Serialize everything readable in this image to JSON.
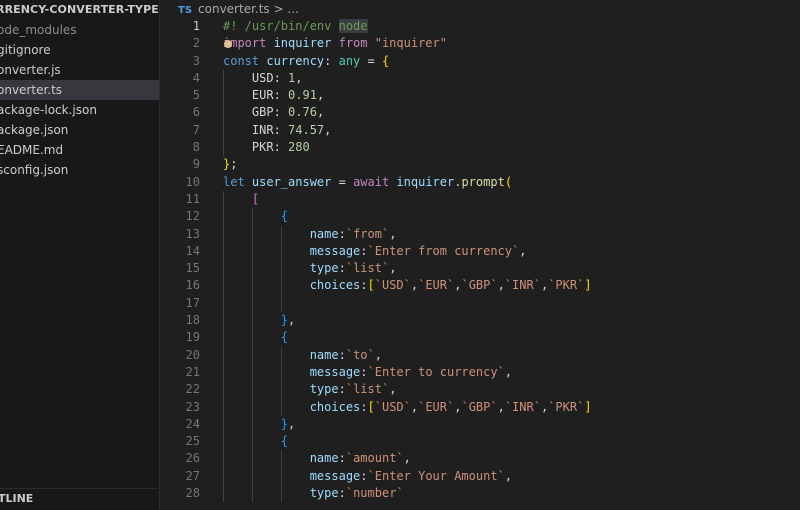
{
  "sidebar": {
    "project_title": "RRENCY-CONVERTER-TYPESCRIPT",
    "items": [
      {
        "label": "ode_modules",
        "dim": true
      },
      {
        "label": "gitignore"
      },
      {
        "label": "onverter.js"
      },
      {
        "label": "onverter.ts",
        "selected": true
      },
      {
        "label": "ackage-lock.json"
      },
      {
        "label": "ackage.json"
      },
      {
        "label": "EADME.md"
      },
      {
        "label": "sconfig.json"
      }
    ],
    "outline_label": "TLINE"
  },
  "breadcrumb": {
    "badge": "TS",
    "file": "converter.ts",
    "separator": ">",
    "rest": "..."
  },
  "code": {
    "lines": [
      [
        [
          "c",
          "#! /usr/bin/env "
        ],
        [
          "c hl",
          "node"
        ]
      ],
      [
        [
          "k",
          "import "
        ],
        [
          "v",
          "inquirer "
        ],
        [
          "k",
          "from "
        ],
        [
          "s",
          "\"inquirer\""
        ]
      ],
      [
        [
          "kb",
          "const "
        ],
        [
          "v",
          "currency"
        ],
        [
          "p",
          ": "
        ],
        [
          "t",
          "any "
        ],
        [
          "p",
          "= "
        ],
        [
          "b1",
          "{"
        ]
      ],
      [
        [
          "p",
          "    USD: "
        ],
        [
          "n",
          "1"
        ],
        [
          "p",
          ","
        ]
      ],
      [
        [
          "p",
          "    EUR: "
        ],
        [
          "n",
          "0.91"
        ],
        [
          "p",
          ","
        ]
      ],
      [
        [
          "p",
          "    GBP: "
        ],
        [
          "n",
          "0.76"
        ],
        [
          "p",
          ","
        ]
      ],
      [
        [
          "p",
          "    INR: "
        ],
        [
          "n",
          "74.57"
        ],
        [
          "p",
          ","
        ]
      ],
      [
        [
          "p",
          "    PKR: "
        ],
        [
          "n",
          "280"
        ]
      ],
      [
        [
          "b1",
          "}"
        ],
        [
          "p",
          ";"
        ]
      ],
      [
        [
          "kb",
          "let "
        ],
        [
          "v",
          "user_answer "
        ],
        [
          "p",
          "= "
        ],
        [
          "k",
          "await "
        ],
        [
          "v",
          "inquirer"
        ],
        [
          "p",
          "."
        ],
        [
          "f",
          "prompt"
        ],
        [
          "b1",
          "("
        ]
      ],
      [
        [
          "p",
          "    "
        ],
        [
          "b2",
          "["
        ]
      ],
      [
        [
          "p",
          "        "
        ],
        [
          "b3",
          "{"
        ]
      ],
      [
        [
          "p",
          "            "
        ],
        [
          "v",
          "name"
        ],
        [
          "p",
          ":"
        ],
        [
          "s",
          "`from`"
        ],
        [
          "p",
          ","
        ]
      ],
      [
        [
          "p",
          "            "
        ],
        [
          "v",
          "message"
        ],
        [
          "p",
          ":"
        ],
        [
          "s",
          "`Enter from currency`"
        ],
        [
          "p",
          ","
        ]
      ],
      [
        [
          "p",
          "            "
        ],
        [
          "v",
          "type"
        ],
        [
          "p",
          ":"
        ],
        [
          "s",
          "`list`"
        ],
        [
          "p",
          ","
        ]
      ],
      [
        [
          "p",
          "            "
        ],
        [
          "v",
          "choices"
        ],
        [
          "p",
          ":"
        ],
        [
          "b1",
          "["
        ],
        [
          "s",
          "`USD`"
        ],
        [
          "p",
          ","
        ],
        [
          "s",
          "`EUR`"
        ],
        [
          "p",
          ","
        ],
        [
          "s",
          "`GBP`"
        ],
        [
          "p",
          ","
        ],
        [
          "s",
          "`INR`"
        ],
        [
          "p",
          ","
        ],
        [
          "s",
          "`PKR`"
        ],
        [
          "b1",
          "]"
        ]
      ],
      [],
      [
        [
          "p",
          "        "
        ],
        [
          "b3",
          "}"
        ],
        [
          "p",
          ","
        ]
      ],
      [
        [
          "p",
          "        "
        ],
        [
          "b3",
          "{"
        ]
      ],
      [
        [
          "p",
          "            "
        ],
        [
          "v",
          "name"
        ],
        [
          "p",
          ":"
        ],
        [
          "s",
          "`to`"
        ],
        [
          "p",
          ","
        ]
      ],
      [
        [
          "p",
          "            "
        ],
        [
          "v",
          "message"
        ],
        [
          "p",
          ":"
        ],
        [
          "s",
          "`Enter to currency`"
        ],
        [
          "p",
          ","
        ]
      ],
      [
        [
          "p",
          "            "
        ],
        [
          "v",
          "type"
        ],
        [
          "p",
          ":"
        ],
        [
          "s",
          "`list`"
        ],
        [
          "p",
          ","
        ]
      ],
      [
        [
          "p",
          "            "
        ],
        [
          "v",
          "choices"
        ],
        [
          "p",
          ":"
        ],
        [
          "b1",
          "["
        ],
        [
          "s",
          "`USD`"
        ],
        [
          "p",
          ","
        ],
        [
          "s",
          "`EUR`"
        ],
        [
          "p",
          ","
        ],
        [
          "s",
          "`GBP`"
        ],
        [
          "p",
          ","
        ],
        [
          "s",
          "`INR`"
        ],
        [
          "p",
          ","
        ],
        [
          "s",
          "`PKR`"
        ],
        [
          "b1",
          "]"
        ]
      ],
      [
        [
          "p",
          "        "
        ],
        [
          "b3",
          "}"
        ],
        [
          "p",
          ","
        ]
      ],
      [
        [
          "p",
          "        "
        ],
        [
          "b3",
          "{"
        ]
      ],
      [
        [
          "p",
          "            "
        ],
        [
          "v",
          "name"
        ],
        [
          "p",
          ":"
        ],
        [
          "s",
          "`amount`"
        ],
        [
          "p",
          ","
        ]
      ],
      [
        [
          "p",
          "            "
        ],
        [
          "v",
          "message"
        ],
        [
          "p",
          ":"
        ],
        [
          "s",
          "`Enter Your Amount`"
        ],
        [
          "p",
          ","
        ]
      ],
      [
        [
          "p",
          "            "
        ],
        [
          "v",
          "type"
        ],
        [
          "p",
          ":"
        ],
        [
          "s",
          "`number`"
        ]
      ]
    ],
    "line_numbers": [
      "1",
      "2",
      "3",
      "4",
      "5",
      "6",
      "7",
      "8",
      "9",
      "10",
      "11",
      "12",
      "13",
      "14",
      "15",
      "16",
      "17",
      "18",
      "19",
      "20",
      "21",
      "22",
      "23",
      "24",
      "25",
      "26",
      "27",
      "28"
    ],
    "active_line": 1
  }
}
